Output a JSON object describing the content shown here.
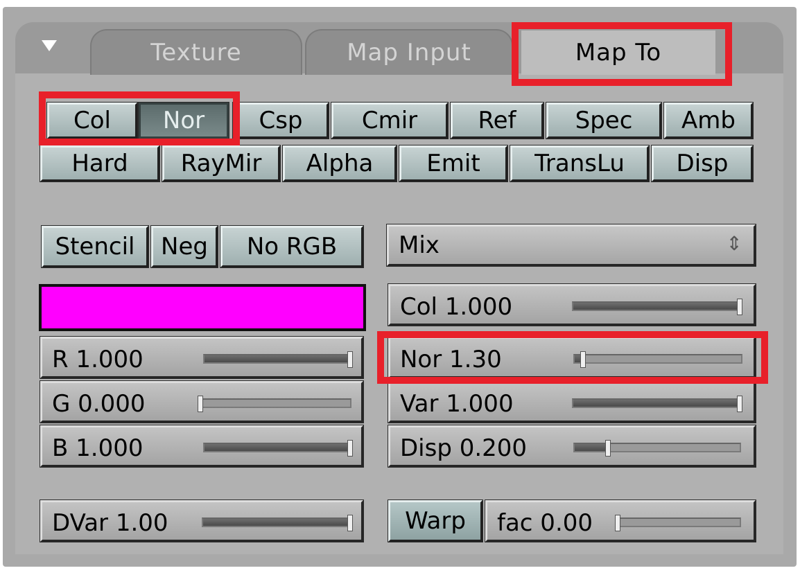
{
  "tabs": [
    {
      "label": "Texture",
      "active": false
    },
    {
      "label": "Map Input",
      "active": false
    },
    {
      "label": "Map To",
      "active": true
    }
  ],
  "map_to_row1": [
    {
      "label": "Col",
      "on": false
    },
    {
      "label": "Nor",
      "on": true
    },
    {
      "label": "Csp",
      "on": false
    },
    {
      "label": "Cmir",
      "on": false
    },
    {
      "label": "Ref",
      "on": false
    },
    {
      "label": "Spec",
      "on": false
    },
    {
      "label": "Amb",
      "on": false
    }
  ],
  "map_to_row2": [
    {
      "label": "Hard",
      "on": false
    },
    {
      "label": "RayMir",
      "on": false
    },
    {
      "label": "Alpha",
      "on": false
    },
    {
      "label": "Emit",
      "on": false
    },
    {
      "label": "TransLu",
      "on": false
    },
    {
      "label": "Disp",
      "on": false
    }
  ],
  "options": [
    {
      "label": "Stencil"
    },
    {
      "label": "Neg"
    },
    {
      "label": "No RGB"
    }
  ],
  "blend_mode": {
    "value": "Mix",
    "arrow": "⇕"
  },
  "color_swatch": "#ff00ff",
  "rgb_sliders": [
    {
      "label": "R 1.000",
      "value": 1.0
    },
    {
      "label": "G 0.000",
      "value": 0.0
    },
    {
      "label": "B 1.000",
      "value": 1.0
    }
  ],
  "dvar": {
    "label": "DVar 1.00",
    "value": 1.0
  },
  "strength_sliders": [
    {
      "label": "Col 1.000",
      "value": 1.0
    },
    {
      "label": "Nor 1.30",
      "value": 0.05
    },
    {
      "label": "Var 1.000",
      "value": 1.0
    },
    {
      "label": "Disp 0.200",
      "value": 0.2
    }
  ],
  "warp": {
    "label": "Warp",
    "on": true
  },
  "fac": {
    "label": "fac 0.00",
    "value": 0.0
  },
  "highlight_color": "#e8202a"
}
